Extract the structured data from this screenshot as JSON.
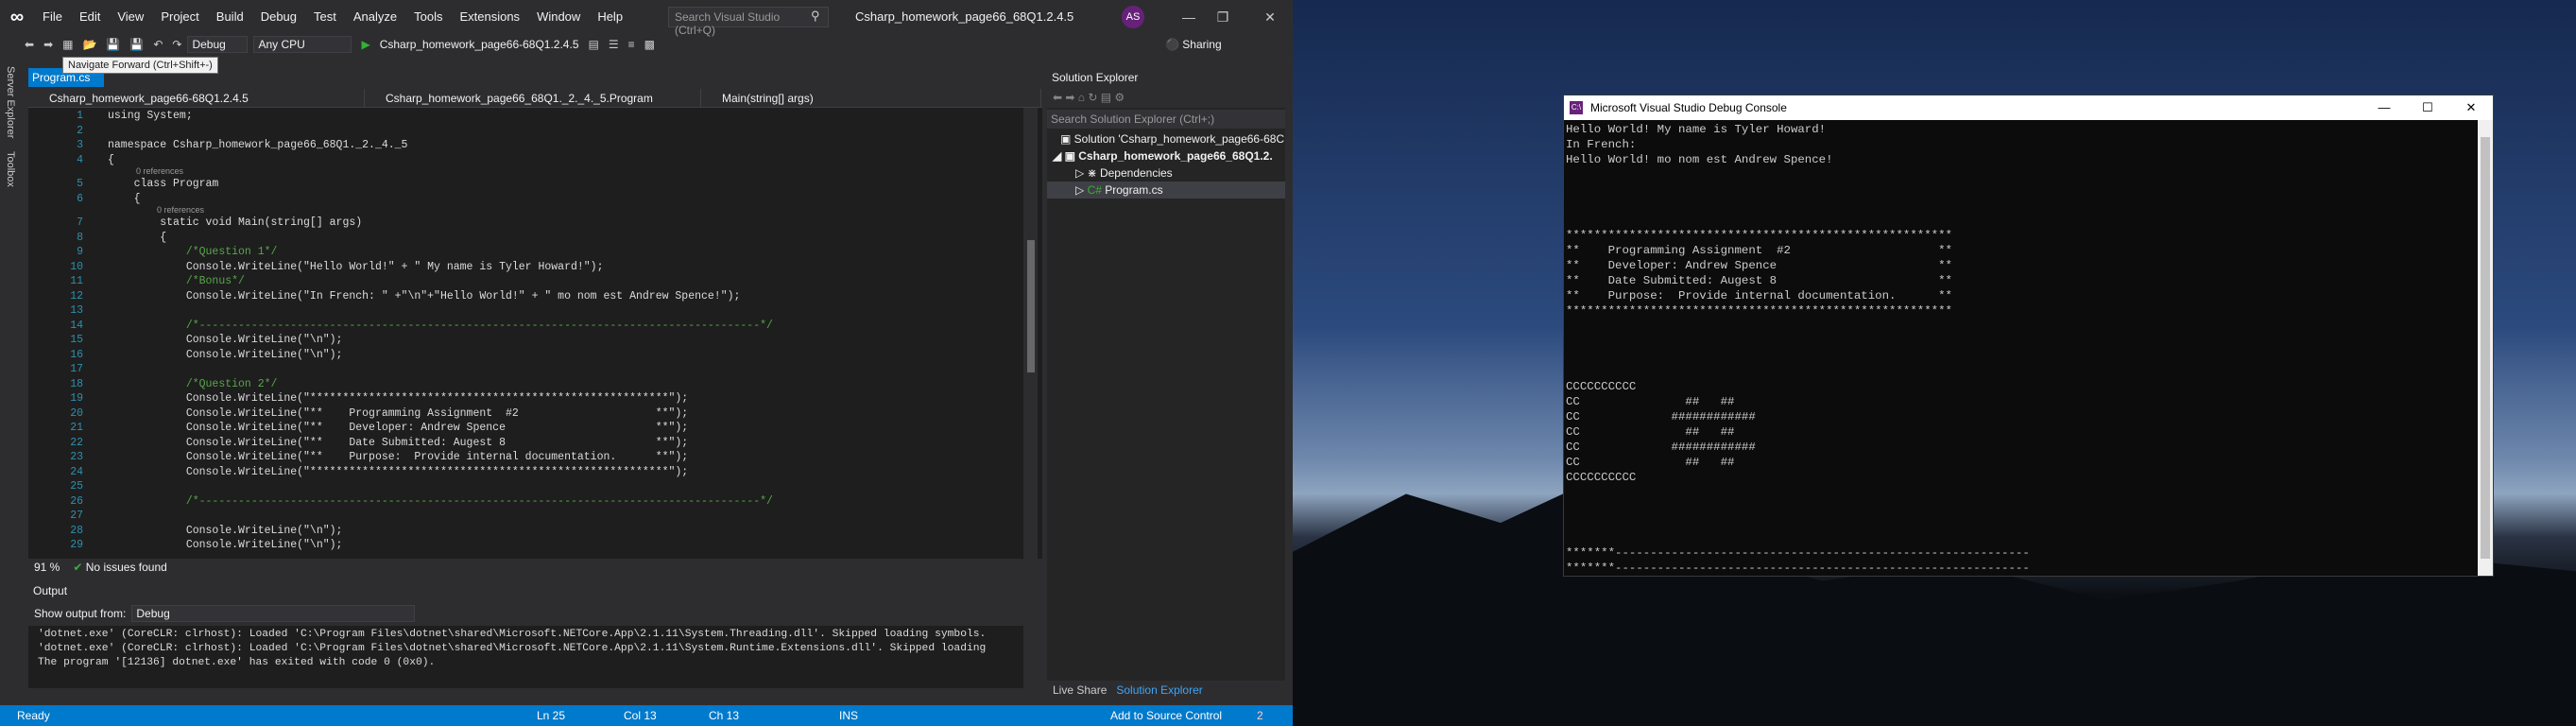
{
  "vs": {
    "menu": [
      "File",
      "Edit",
      "View",
      "Project",
      "Build",
      "Debug",
      "Test",
      "Analyze",
      "Tools",
      "Extensions",
      "Window",
      "Help"
    ],
    "search_placeholder": "Search Visual Studio (Ctrl+Q)",
    "project_title": "Csharp_homework_page66_68Q1.2.4.5",
    "avatar": "AS",
    "sharing": "Sharing",
    "config": "Debug",
    "platform": "Any CPU",
    "run_target": "Csharp_homework_page66-68Q1.2.4.5",
    "tooltip": "Navigate Forward (Ctrl+Shift+-)",
    "side_tabs": [
      "Server Explorer",
      "Toolbox"
    ],
    "doc_tab": "Program.cs",
    "nav": [
      "Csharp_homework_page66-68Q1.2.4.5",
      "Csharp_homework_page66_68Q1._2._4._5.Program",
      "Main(string[] args)"
    ],
    "zoom": "91 %",
    "issues": "No issues found",
    "output_title": "Output",
    "output_from_label": "Show output from:",
    "output_from_value": "Debug",
    "output_lines": [
      "'dotnet.exe' (CoreCLR: clrhost): Loaded 'C:\\Program Files\\dotnet\\shared\\Microsoft.NETCore.App\\2.1.11\\System.Threading.dll'. Skipped loading symbols.",
      "'dotnet.exe' (CoreCLR: clrhost): Loaded 'C:\\Program Files\\dotnet\\shared\\Microsoft.NETCore.App\\2.1.11\\System.Runtime.Extensions.dll'. Skipped loading",
      "The program '[12136] dotnet.exe' has exited with code 0 (0x0)."
    ],
    "refs": "0 references",
    "status": {
      "ready": "Ready",
      "ln": "Ln 25",
      "col": "Col 13",
      "ch": "Ch 13",
      "ins": "INS",
      "source": "Add to Source Control",
      "errors": "2"
    }
  },
  "code_lines": [
    {
      "n": "1",
      "t": "using System;"
    },
    {
      "n": "2",
      "t": ""
    },
    {
      "n": "3",
      "t": "namespace Csharp_homework_page66_68Q1._2._4._5"
    },
    {
      "n": "4",
      "t": "{"
    },
    {
      "n": "5",
      "t": "    class Program"
    },
    {
      "n": "6",
      "t": "    {"
    },
    {
      "n": "7",
      "t": "        static void Main(string[] args)"
    },
    {
      "n": "8",
      "t": "        {"
    },
    {
      "n": "9",
      "t": "            /*Question 1*/"
    },
    {
      "n": "10",
      "t": "            Console.WriteLine(\"Hello World!\" + \" My name is Tyler Howard!\");"
    },
    {
      "n": "11",
      "t": "            /*Bonus*/"
    },
    {
      "n": "12",
      "t": "            Console.WriteLine(\"In French: \" +\"\\n\"+\"Hello World!\" + \" mo nom est Andrew Spence!\");"
    },
    {
      "n": "13",
      "t": ""
    },
    {
      "n": "14",
      "t": "            /*--------------------------------------------------------------------------------------*/"
    },
    {
      "n": "15",
      "t": "            Console.WriteLine(\"\\n\");"
    },
    {
      "n": "16",
      "t": "            Console.WriteLine(\"\\n\");"
    },
    {
      "n": "17",
      "t": ""
    },
    {
      "n": "18",
      "t": "            /*Question 2*/"
    },
    {
      "n": "19",
      "t": "            Console.WriteLine(\"*******************************************************\");"
    },
    {
      "n": "20",
      "t": "            Console.WriteLine(\"**    Programming Assignment  #2                     **\");"
    },
    {
      "n": "21",
      "t": "            Console.WriteLine(\"**    Developer: Andrew Spence                       **\");"
    },
    {
      "n": "22",
      "t": "            Console.WriteLine(\"**    Date Submitted: Augest 8                       **\");"
    },
    {
      "n": "23",
      "t": "            Console.WriteLine(\"**    Purpose:  Provide internal documentation.      **\");"
    },
    {
      "n": "24",
      "t": "            Console.WriteLine(\"*******************************************************\");"
    },
    {
      "n": "25",
      "t": ""
    },
    {
      "n": "26",
      "t": "            /*--------------------------------------------------------------------------------------*/"
    },
    {
      "n": "27",
      "t": ""
    },
    {
      "n": "28",
      "t": "            Console.WriteLine(\"\\n\");"
    },
    {
      "n": "29",
      "t": "            Console.WriteLine(\"\\n\");"
    }
  ],
  "solution": {
    "title": "Solution Explorer",
    "search": "Search Solution Explorer (Ctrl+;)",
    "items": [
      "Solution 'Csharp_homework_page66-68C",
      "Csharp_homework_page66_68Q1.2.",
      "Dependencies",
      "Program.cs"
    ],
    "footer": [
      "Live Share",
      "Solution Explorer"
    ]
  },
  "console": {
    "title": "Microsoft Visual Studio Debug Console",
    "lines": [
      "Hello World! My name is Tyler Howard!",
      "In French:",
      "Hello World! mo nom est Andrew Spence!",
      "",
      "",
      "",
      "",
      "*******************************************************",
      "**    Programming Assignment  #2                     **",
      "**    Developer: Andrew Spence                       **",
      "**    Date Submitted: Augest 8                       **",
      "**    Purpose:  Provide internal documentation.      **",
      "*******************************************************",
      "",
      "",
      "",
      "",
      "CCCCCCCCCC",
      "CC               ##   ##",
      "CC             ############",
      "CC               ##   ##",
      "CC             ############",
      "CC               ##   ##",
      "CCCCCCCCCC",
      "",
      "",
      "",
      "",
      "*******-----------------------------------------------------------",
      "*******-----------------------------------------------------------"
    ]
  },
  "colors": {
    "accent": "#007acc",
    "vs_bg": "#2d2d30",
    "editor_bg": "#1e1e1e",
    "console_bg": "#0c0c0c"
  }
}
